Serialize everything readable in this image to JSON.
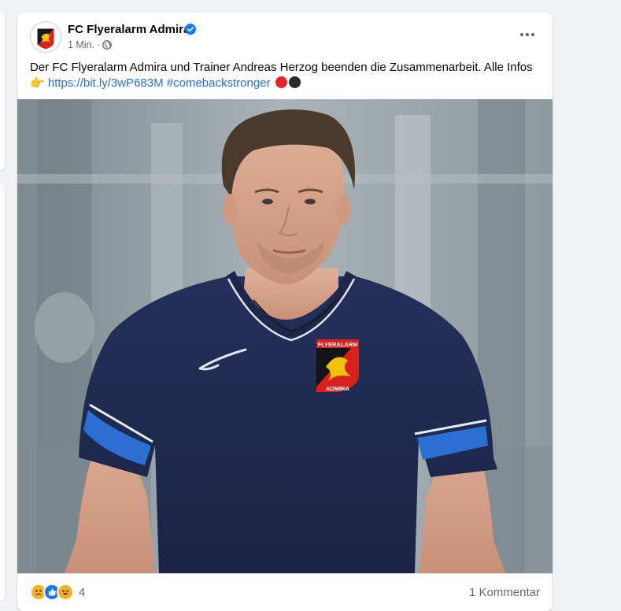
{
  "post": {
    "page_name": "FC Flyeralarm Admira",
    "time": "1 Min.",
    "audience_icon": "globe-icon",
    "text_intro": "Der FC Flyeralarm Admira und Trainer Andreas Herzog beenden die Zusammenarbeit. Alle Infos",
    "pointing_emoji": "👉",
    "link_text": "https://bit.ly/3wP683M",
    "hashtag": "#comebackstronger",
    "image_alt": "Trainer im dunkelblauen Admira-Poloshirt",
    "crest_text_top": "FLYERALARM",
    "crest_text_bottom": "ADMIRA",
    "reactions": {
      "icons": [
        "sad-icon",
        "like-icon",
        "haha-icon"
      ],
      "count": "4"
    },
    "comments": "1 Kommentar"
  },
  "colors": {
    "link": "#216fdb",
    "verified": "#1877f2",
    "shirt": "#1e2a4e",
    "shirt_stripe": "#2a6fd1",
    "crest_red": "#d8201d",
    "crest_yellow": "#f2c10f"
  }
}
